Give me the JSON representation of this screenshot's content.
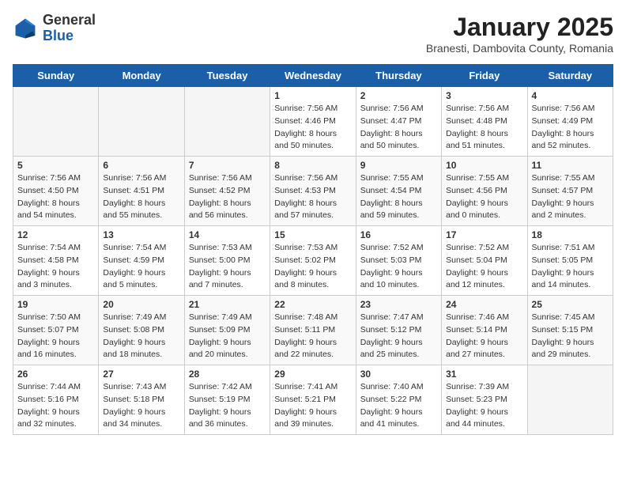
{
  "header": {
    "logo_line1": "General",
    "logo_line2": "Blue",
    "title": "January 2025",
    "subtitle": "Branesti, Dambovita County, Romania"
  },
  "weekdays": [
    "Sunday",
    "Monday",
    "Tuesday",
    "Wednesday",
    "Thursday",
    "Friday",
    "Saturday"
  ],
  "weeks": [
    [
      {
        "day": "",
        "info": ""
      },
      {
        "day": "",
        "info": ""
      },
      {
        "day": "",
        "info": ""
      },
      {
        "day": "1",
        "info": "Sunrise: 7:56 AM\nSunset: 4:46 PM\nDaylight: 8 hours\nand 50 minutes."
      },
      {
        "day": "2",
        "info": "Sunrise: 7:56 AM\nSunset: 4:47 PM\nDaylight: 8 hours\nand 50 minutes."
      },
      {
        "day": "3",
        "info": "Sunrise: 7:56 AM\nSunset: 4:48 PM\nDaylight: 8 hours\nand 51 minutes."
      },
      {
        "day": "4",
        "info": "Sunrise: 7:56 AM\nSunset: 4:49 PM\nDaylight: 8 hours\nand 52 minutes."
      }
    ],
    [
      {
        "day": "5",
        "info": "Sunrise: 7:56 AM\nSunset: 4:50 PM\nDaylight: 8 hours\nand 54 minutes."
      },
      {
        "day": "6",
        "info": "Sunrise: 7:56 AM\nSunset: 4:51 PM\nDaylight: 8 hours\nand 55 minutes."
      },
      {
        "day": "7",
        "info": "Sunrise: 7:56 AM\nSunset: 4:52 PM\nDaylight: 8 hours\nand 56 minutes."
      },
      {
        "day": "8",
        "info": "Sunrise: 7:56 AM\nSunset: 4:53 PM\nDaylight: 8 hours\nand 57 minutes."
      },
      {
        "day": "9",
        "info": "Sunrise: 7:55 AM\nSunset: 4:54 PM\nDaylight: 8 hours\nand 59 minutes."
      },
      {
        "day": "10",
        "info": "Sunrise: 7:55 AM\nSunset: 4:56 PM\nDaylight: 9 hours\nand 0 minutes."
      },
      {
        "day": "11",
        "info": "Sunrise: 7:55 AM\nSunset: 4:57 PM\nDaylight: 9 hours\nand 2 minutes."
      }
    ],
    [
      {
        "day": "12",
        "info": "Sunrise: 7:54 AM\nSunset: 4:58 PM\nDaylight: 9 hours\nand 3 minutes."
      },
      {
        "day": "13",
        "info": "Sunrise: 7:54 AM\nSunset: 4:59 PM\nDaylight: 9 hours\nand 5 minutes."
      },
      {
        "day": "14",
        "info": "Sunrise: 7:53 AM\nSunset: 5:00 PM\nDaylight: 9 hours\nand 7 minutes."
      },
      {
        "day": "15",
        "info": "Sunrise: 7:53 AM\nSunset: 5:02 PM\nDaylight: 9 hours\nand 8 minutes."
      },
      {
        "day": "16",
        "info": "Sunrise: 7:52 AM\nSunset: 5:03 PM\nDaylight: 9 hours\nand 10 minutes."
      },
      {
        "day": "17",
        "info": "Sunrise: 7:52 AM\nSunset: 5:04 PM\nDaylight: 9 hours\nand 12 minutes."
      },
      {
        "day": "18",
        "info": "Sunrise: 7:51 AM\nSunset: 5:05 PM\nDaylight: 9 hours\nand 14 minutes."
      }
    ],
    [
      {
        "day": "19",
        "info": "Sunrise: 7:50 AM\nSunset: 5:07 PM\nDaylight: 9 hours\nand 16 minutes."
      },
      {
        "day": "20",
        "info": "Sunrise: 7:49 AM\nSunset: 5:08 PM\nDaylight: 9 hours\nand 18 minutes."
      },
      {
        "day": "21",
        "info": "Sunrise: 7:49 AM\nSunset: 5:09 PM\nDaylight: 9 hours\nand 20 minutes."
      },
      {
        "day": "22",
        "info": "Sunrise: 7:48 AM\nSunset: 5:11 PM\nDaylight: 9 hours\nand 22 minutes."
      },
      {
        "day": "23",
        "info": "Sunrise: 7:47 AM\nSunset: 5:12 PM\nDaylight: 9 hours\nand 25 minutes."
      },
      {
        "day": "24",
        "info": "Sunrise: 7:46 AM\nSunset: 5:14 PM\nDaylight: 9 hours\nand 27 minutes."
      },
      {
        "day": "25",
        "info": "Sunrise: 7:45 AM\nSunset: 5:15 PM\nDaylight: 9 hours\nand 29 minutes."
      }
    ],
    [
      {
        "day": "26",
        "info": "Sunrise: 7:44 AM\nSunset: 5:16 PM\nDaylight: 9 hours\nand 32 minutes."
      },
      {
        "day": "27",
        "info": "Sunrise: 7:43 AM\nSunset: 5:18 PM\nDaylight: 9 hours\nand 34 minutes."
      },
      {
        "day": "28",
        "info": "Sunrise: 7:42 AM\nSunset: 5:19 PM\nDaylight: 9 hours\nand 36 minutes."
      },
      {
        "day": "29",
        "info": "Sunrise: 7:41 AM\nSunset: 5:21 PM\nDaylight: 9 hours\nand 39 minutes."
      },
      {
        "day": "30",
        "info": "Sunrise: 7:40 AM\nSunset: 5:22 PM\nDaylight: 9 hours\nand 41 minutes."
      },
      {
        "day": "31",
        "info": "Sunrise: 7:39 AM\nSunset: 5:23 PM\nDaylight: 9 hours\nand 44 minutes."
      },
      {
        "day": "",
        "info": ""
      }
    ]
  ]
}
